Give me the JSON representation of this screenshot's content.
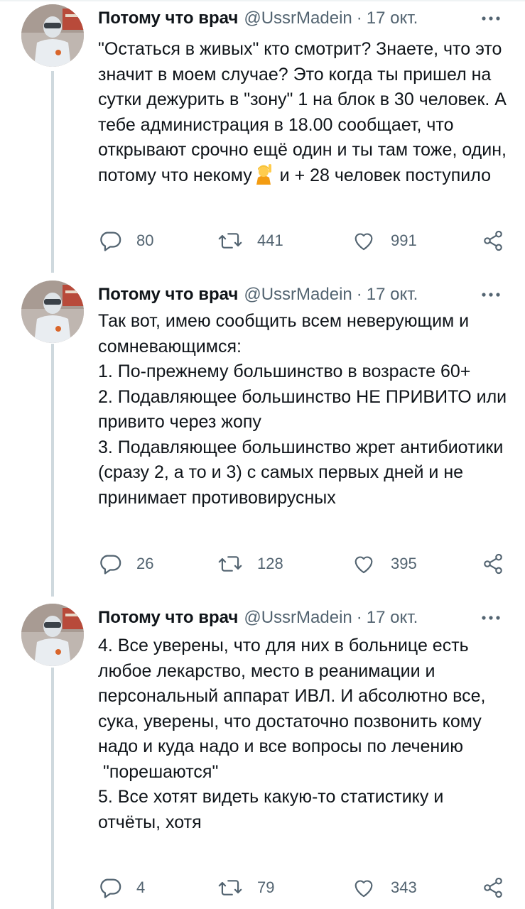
{
  "tweets": [
    {
      "name": "Потому что врач",
      "handle": "@UssrMadein",
      "separator": "·",
      "date": "17 окт.",
      "text_before_emoji": "\"Остаться в живых\" кто смотрит? Знаете, что это значит в моем случае? Это когда ты пришел на сутки дежурить в \"зону\" 1 на блок в 30 человек. А тебе администрация в 18.00 сообщает, что открывают срочно ещё один и ты там тоже, один, потому что некому",
      "emoji": "person-raising-hand-emoji",
      "text_after_emoji": " и + 28 человек поступило",
      "replies": "80",
      "retweets": "441",
      "likes": "991"
    },
    {
      "name": "Потому что врач",
      "handle": "@UssrMadein",
      "separator": "·",
      "date": "17 окт.",
      "text": "Так вот, имею сообщить всем неверующим и сомневающимся:\n1. По-прежнему большинство в возрасте 60+\n2. Подавляющее большинство НЕ ПРИВИТО или привито через жопу\n3. Подавляющее большинство жрет антибиотики (сразу 2, а то и 3) с самых первых дней и не принимает противовирусных",
      "replies": "26",
      "retweets": "128",
      "likes": "395"
    },
    {
      "name": "Потому что врач",
      "handle": "@UssrMadein",
      "separator": "·",
      "date": "17 окт.",
      "text": "4. Все уверены, что для них в больнице есть любое лекарство, место в реанимации и персональный аппарат ИВЛ. И абсолютно все, сука, уверены, что достаточно позвонить кому надо и куда надо и все вопросы по лечению\n \"порешаются\"\n5. Все хотят видеть какую-то статистику и отчёты, хотя",
      "replies": "4",
      "retweets": "79",
      "likes": "343"
    }
  ],
  "icons": {
    "reply": "reply-icon",
    "retweet": "retweet-icon",
    "like": "heart-icon",
    "share": "share-icon",
    "more": "more-options-icon"
  },
  "colors": {
    "text": "#0f1419",
    "secondary": "#536471",
    "thread_line": "#cfd9de",
    "background": "#ffffff"
  }
}
